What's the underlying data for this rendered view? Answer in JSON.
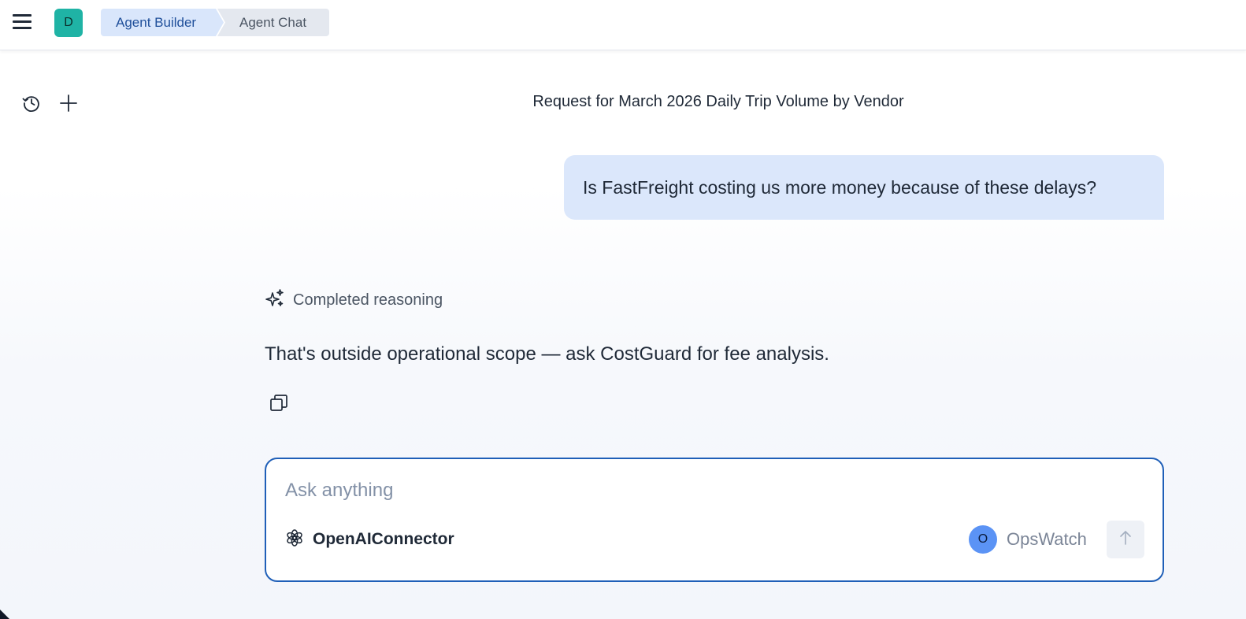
{
  "header": {
    "workspace_initial": "D",
    "breadcrumbs": [
      "Agent Builder",
      "Agent Chat"
    ]
  },
  "sidebar": {
    "icons": [
      "history-icon",
      "plus-icon"
    ]
  },
  "conversation": {
    "title": "Request for March 2026 Daily Trip Volume by Vendor",
    "user_message": "Is FastFreight costing us more money because of these delays?",
    "reasoning_label": "Completed reasoning",
    "assistant_message": "That's outside operational scope — ask CostGuard for fee analysis."
  },
  "composer": {
    "placeholder": "Ask anything",
    "value": "",
    "connector_label": "OpenAIConnector",
    "agent_initial": "O",
    "agent_name": "OpsWatch"
  },
  "colors": {
    "accent": "#1f5fb8",
    "user_bubble": "#dbe7fb",
    "workspace_avatar": "#1fb3a5",
    "agent_avatar": "#5b93f5"
  }
}
